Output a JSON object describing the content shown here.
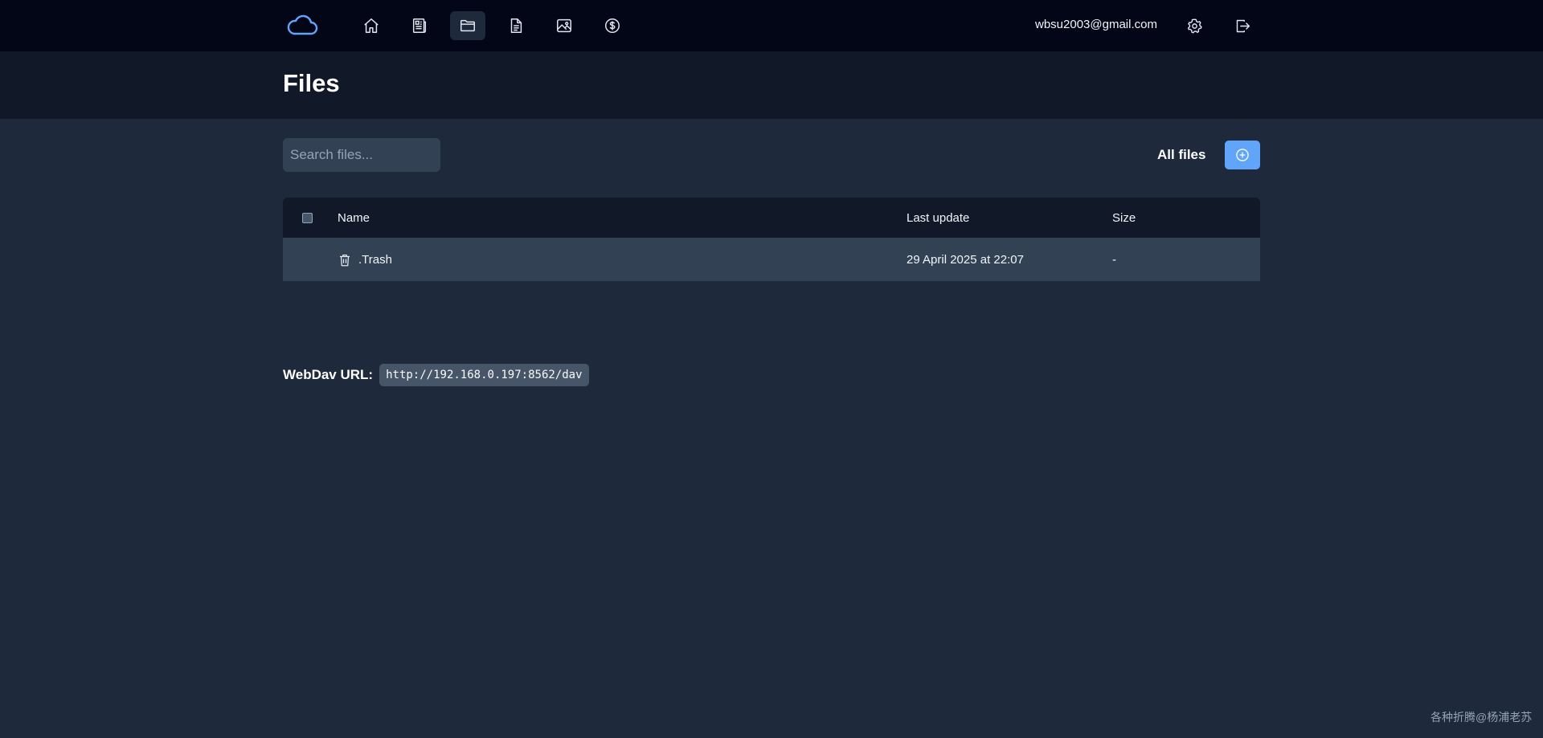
{
  "nav": {
    "items": [
      {
        "name": "home-icon",
        "active": false
      },
      {
        "name": "newspaper-icon",
        "active": false
      },
      {
        "name": "folder-icon",
        "active": true
      },
      {
        "name": "document-icon",
        "active": false
      },
      {
        "name": "image-icon",
        "active": false
      },
      {
        "name": "dollar-icon",
        "active": false
      }
    ],
    "user_email": "wbsu2003@gmail.com",
    "settings_icon": "gear-icon",
    "logout_icon": "logout-icon"
  },
  "page": {
    "title": "Files"
  },
  "toolbar": {
    "search_placeholder": "Search files...",
    "filter_label": "All files",
    "add_icon": "plus-circle-icon"
  },
  "table": {
    "headers": {
      "name": "Name",
      "last_update": "Last update",
      "size": "Size"
    },
    "rows": [
      {
        "icon": "trash-icon",
        "name": ".Trash",
        "last_update": "29 April 2025 at 22:07",
        "size": "-"
      }
    ]
  },
  "webdav": {
    "label": "WebDav URL:",
    "url": "http://192.168.0.197:8562/dav"
  },
  "watermark": "各种折腾@杨浦老苏",
  "colors": {
    "accent": "#60a5fa",
    "topbar": "#020617",
    "background": "#1e293b"
  }
}
